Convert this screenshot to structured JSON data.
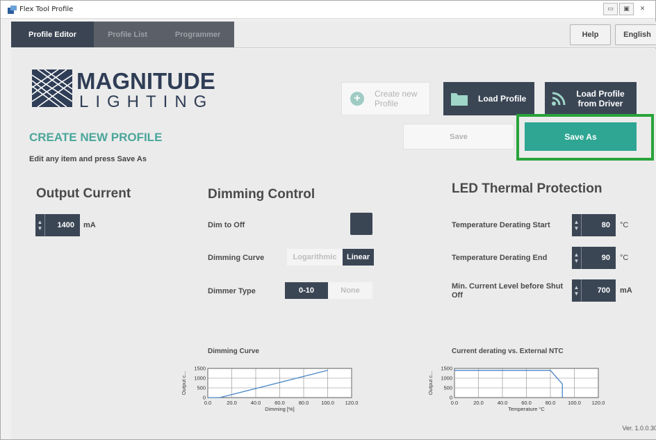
{
  "window": {
    "title": "Flex Tool Profile"
  },
  "tabs": [
    {
      "label": "Profile Editor",
      "active": true
    },
    {
      "label": "Profile List",
      "active": false
    },
    {
      "label": "Programmer",
      "active": false
    }
  ],
  "top_buttons": {
    "help": "Help",
    "language": "English"
  },
  "brand": {
    "line1": "MAGNITUDE",
    "line2": "LIGHTING"
  },
  "actions": {
    "create_new": "Create new Profile",
    "load_profile": "Load Profile",
    "load_from_driver": "Load Profile from Driver",
    "save": "Save",
    "save_as": "Save As"
  },
  "page": {
    "title": "CREATE NEW PROFILE",
    "subtitle": "Edit any item and press Save As"
  },
  "output_current": {
    "title": "Output Current",
    "value": "1400",
    "unit": "mA"
  },
  "dimming_control": {
    "title": "Dimming Control",
    "dim_to_off_label": "Dim to Off",
    "curve_label": "Dimming Curve",
    "curve_options": [
      "Logarithmic",
      "Linear"
    ],
    "curve_selected": "Linear",
    "dimmer_type_label": "Dimmer Type",
    "dimmer_type_options": [
      "0-10",
      "None"
    ],
    "dimmer_type_selected": "0-10"
  },
  "thermal": {
    "title": "LED Thermal Protection",
    "derating_start_label": "Temperature Derating Start",
    "derating_start_value": "80",
    "derating_start_unit": "°C",
    "derating_end_label": "Temperature Derating End",
    "derating_end_value": "90",
    "derating_end_unit": "°C",
    "min_current_label": "Min. Current Level before Shut Off",
    "min_current_value": "700",
    "min_current_unit": "mA"
  },
  "chart_data": [
    {
      "type": "line",
      "title": "Dimming Curve",
      "xlabel": "Dimming [%]",
      "ylabel": "Output c...",
      "x_ticks": [
        "0.0",
        "20.0",
        "40.0",
        "60.0",
        "80.0",
        "100.0",
        "120.0"
      ],
      "y_ticks": [
        "0",
        "500",
        "1000",
        "1500"
      ],
      "xlim": [
        0,
        120
      ],
      "ylim": [
        0,
        1500
      ],
      "series": [
        {
          "x": [
            0,
            10,
            100
          ],
          "y": [
            0,
            0,
            1400
          ]
        }
      ],
      "grid": true
    },
    {
      "type": "line",
      "title": "Current derating vs. External NTC",
      "xlabel": "Temperature °C",
      "ylabel": "Output c...",
      "x_ticks": [
        "0.0",
        "20.0",
        "40.0",
        "60.0",
        "80.0",
        "100.0",
        "120.0"
      ],
      "y_ticks": [
        "0",
        "500",
        "1000",
        "1500"
      ],
      "xlim": [
        0,
        120
      ],
      "ylim": [
        0,
        1500
      ],
      "series": [
        {
          "x": [
            0,
            80,
            90,
            90
          ],
          "y": [
            1400,
            1400,
            700,
            0
          ]
        }
      ],
      "grid": true
    }
  ],
  "version": "Ver. 1.0.0.30",
  "colors": {
    "accent": "#2ea693",
    "dark": "#3b4655",
    "highlight": "#2aa33a",
    "series": "#4a86c8"
  }
}
